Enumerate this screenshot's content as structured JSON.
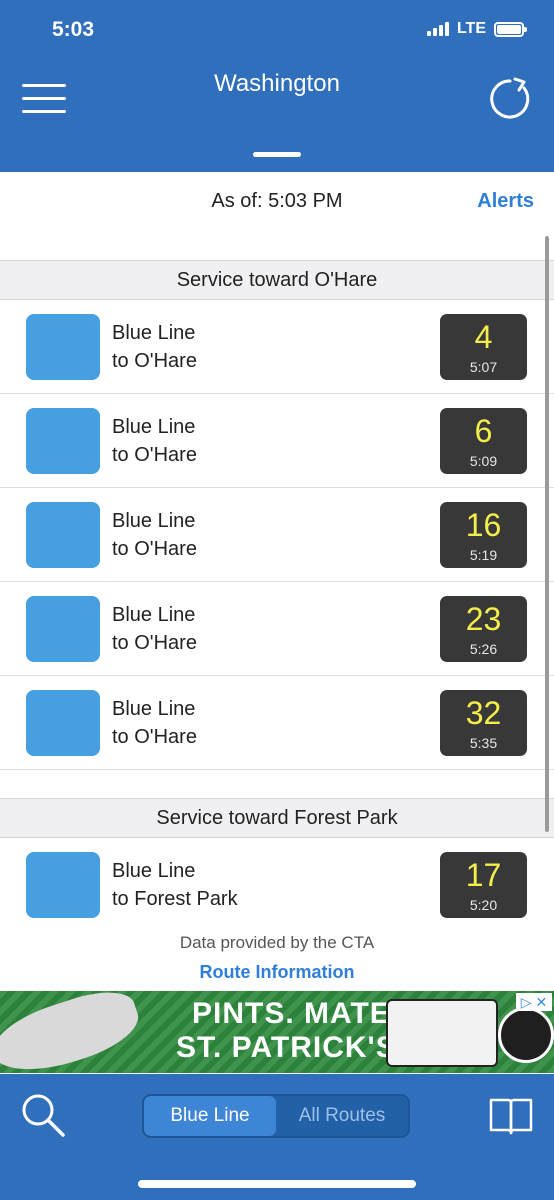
{
  "status_bar": {
    "time": "5:03",
    "network": "LTE"
  },
  "header": {
    "title": "Washington"
  },
  "refresh_info": {
    "as_of": "As of: 5:03 PM",
    "alerts_label": "Alerts"
  },
  "sections": [
    {
      "title": "Service toward O'Hare",
      "arrivals": [
        {
          "line": "Blue Line",
          "destination": "to O'Hare",
          "minutes": "4",
          "time": "5:07"
        },
        {
          "line": "Blue Line",
          "destination": "to O'Hare",
          "minutes": "6",
          "time": "5:09"
        },
        {
          "line": "Blue Line",
          "destination": "to O'Hare",
          "minutes": "16",
          "time": "5:19"
        },
        {
          "line": "Blue Line",
          "destination": "to O'Hare",
          "minutes": "23",
          "time": "5:26"
        },
        {
          "line": "Blue Line",
          "destination": "to O'Hare",
          "minutes": "32",
          "time": "5:35"
        }
      ]
    },
    {
      "title": "Service toward Forest Park",
      "arrivals": [
        {
          "line": "Blue Line",
          "destination": "to Forest Park",
          "minutes": "17",
          "time": "5:20"
        }
      ]
    }
  ],
  "footer": {
    "credit": "Data provided by the CTA",
    "route_info_label": "Route Information"
  },
  "ad": {
    "line1": "PINTS. MATES.",
    "line2": "ST. PATRICK'S DAY.",
    "close_label": "▷ ✕"
  },
  "tab_bar": {
    "segments": [
      "Blue Line",
      "All Routes"
    ],
    "selected": "Blue Line"
  },
  "colors": {
    "header_blue": "#2f6fbb",
    "line_blue": "#459fe0",
    "eta_yellow": "#f4ee4b",
    "link_blue": "#2f7fd8"
  }
}
